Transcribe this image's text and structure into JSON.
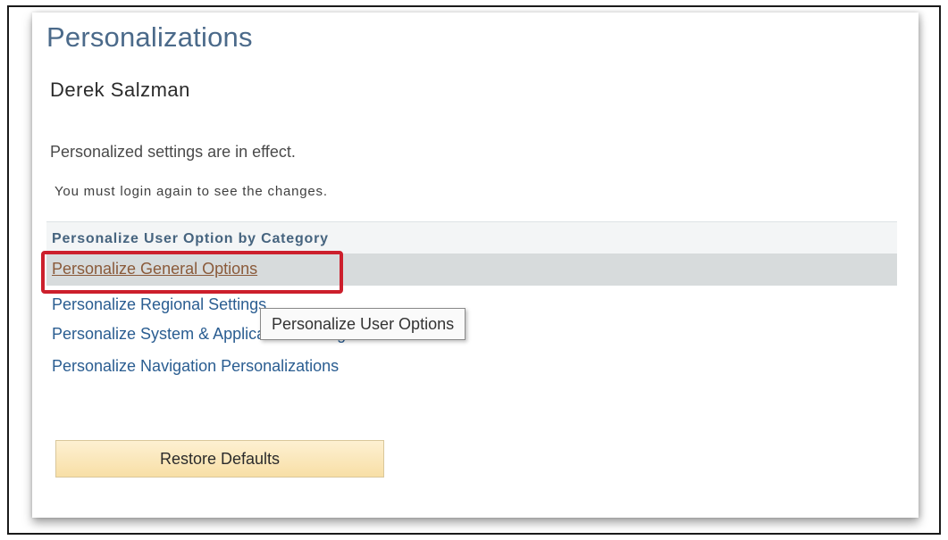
{
  "page": {
    "title": "Personalizations",
    "user_name": "Derek Salzman",
    "status_message": "Personalized settings are in effect.",
    "login_notice": "You must login again to see the changes."
  },
  "category_section": {
    "header": "Personalize User Option by Category",
    "links": [
      "Personalize General Options",
      "Personalize Regional Settings",
      "Personalize System & Application Settings",
      "Personalize Navigation Personalizations"
    ]
  },
  "tooltip": {
    "text": "Personalize User Options"
  },
  "buttons": {
    "restore_defaults": "Restore Defaults"
  },
  "colors": {
    "title": "#4b6a8a",
    "link": "#2a5d91",
    "visited_link": "#8a5a3a",
    "highlight_box": "#cc1f2c",
    "button_fill": "#f8dfa6"
  }
}
